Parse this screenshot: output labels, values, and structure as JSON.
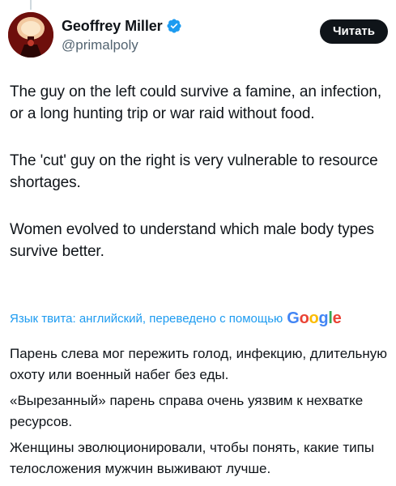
{
  "author": {
    "display_name": "Geoffrey Miller",
    "handle": "@primalpoly",
    "verified_icon": "verified-badge-icon",
    "avatar_icon": "avatar-image"
  },
  "follow_button": {
    "label": "Читать"
  },
  "tweet": {
    "paragraphs": [
      "The guy on the left could survive a famine, an infection, or a long hunting trip or war raid without food.",
      "The 'cut' guy on the right is very vulnerable to resource shortages.",
      "Women evolved to understand which male body types survive better."
    ]
  },
  "translation": {
    "notice": "Язык твита: английский, переведено с помощью",
    "provider": "Google",
    "provider_letters": [
      "G",
      "o",
      "o",
      "g",
      "l",
      "e"
    ],
    "provider_colors": [
      "#4285F4",
      "#EA4335",
      "#FBBC05",
      "#4285F4",
      "#34A853",
      "#EA4335"
    ],
    "paragraphs": [
      "Парень слева мог пережить голод, инфекцию, длительную охоту или военный набег без еды.",
      "«Вырезанный» парень справа очень уязвим к нехватке ресурсов.",
      "Женщины эволюционировали, чтобы понять, какие типы телосложения мужчин выживают лучше."
    ]
  },
  "colors": {
    "accent": "#1d9bf0",
    "text": "#0f1419",
    "secondary_text": "#536471",
    "button_bg": "#0f1419",
    "verified": "#1d9bf0"
  }
}
